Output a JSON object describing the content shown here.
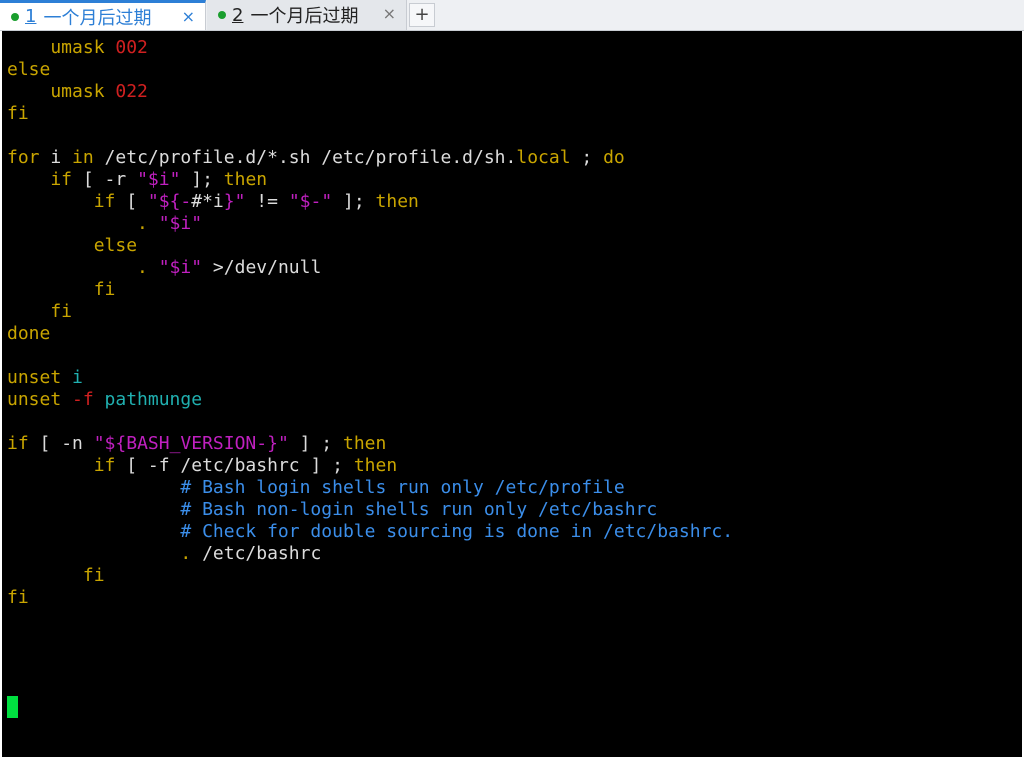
{
  "tabs": [
    {
      "number": "1",
      "title": "一个月后过期",
      "active": true,
      "close": "×",
      "status": "connected"
    },
    {
      "number": "2",
      "title": "一个月后过期",
      "active": false,
      "close": "×",
      "status": "connected"
    }
  ],
  "new_tab_label": "+",
  "colors": {
    "background": "#000000",
    "default": "#dcdcdc",
    "keyword": "#c9a500",
    "number": "#d02020",
    "string": "#c020c0",
    "variable": "#20b0b0",
    "comment": "#3b8eea",
    "cursor": "#00e040",
    "accent": "#2d7fd6"
  },
  "terminal": {
    "lines": [
      [
        [
          "    umask ",
          "keyword"
        ],
        [
          "002",
          "number"
        ]
      ],
      [
        [
          "else",
          "keyword"
        ]
      ],
      [
        [
          "    umask ",
          "keyword"
        ],
        [
          "022",
          "number"
        ]
      ],
      [
        [
          "fi",
          "keyword"
        ]
      ],
      [],
      [
        [
          "for",
          "keyword"
        ],
        [
          " i ",
          "default"
        ],
        [
          "in",
          "keyword"
        ],
        [
          " /etc/profile.d/*.sh /etc/profile.d/sh.",
          "default"
        ],
        [
          "local",
          "keyword"
        ],
        [
          " ; ",
          "default"
        ],
        [
          "do",
          "keyword"
        ]
      ],
      [
        [
          "    if",
          "keyword"
        ],
        [
          " [ -r ",
          "default"
        ],
        [
          "\"$i\"",
          "string"
        ],
        [
          " ]; ",
          "default"
        ],
        [
          "then",
          "keyword"
        ]
      ],
      [
        [
          "        if",
          "keyword"
        ],
        [
          " [ ",
          "default"
        ],
        [
          "\"${-",
          "string"
        ],
        [
          "#*i",
          "default"
        ],
        [
          "}\"",
          "string"
        ],
        [
          " != ",
          "default"
        ],
        [
          "\"$-\"",
          "string"
        ],
        [
          " ]; ",
          "default"
        ],
        [
          "then",
          "keyword"
        ]
      ],
      [
        [
          "            . ",
          "keyword"
        ],
        [
          "\"$i\"",
          "string"
        ]
      ],
      [
        [
          "        else",
          "keyword"
        ]
      ],
      [
        [
          "            . ",
          "keyword"
        ],
        [
          "\"$i\"",
          "string"
        ],
        [
          " >",
          "default"
        ],
        [
          "/dev/null",
          "default"
        ]
      ],
      [
        [
          "        fi",
          "keyword"
        ]
      ],
      [
        [
          "    fi",
          "keyword"
        ]
      ],
      [
        [
          "done",
          "keyword"
        ]
      ],
      [],
      [
        [
          "unset",
          "keyword"
        ],
        [
          " i",
          "variable"
        ]
      ],
      [
        [
          "unset",
          "keyword"
        ],
        [
          " -f",
          "number"
        ],
        [
          " pathmunge",
          "variable"
        ]
      ],
      [],
      [
        [
          "if",
          "keyword"
        ],
        [
          " [ -n ",
          "default"
        ],
        [
          "\"${BASH_VERSION-}\"",
          "string"
        ],
        [
          " ] ; ",
          "default"
        ],
        [
          "then",
          "keyword"
        ]
      ],
      [
        [
          "        if",
          "keyword"
        ],
        [
          " [ -f ",
          "default"
        ],
        [
          "/etc/bashrc",
          "default"
        ],
        [
          " ] ; ",
          "default"
        ],
        [
          "then",
          "keyword"
        ]
      ],
      [
        [
          "                # Bash login shells run only /etc/profile",
          "comment"
        ]
      ],
      [
        [
          "                # Bash non-login shells run only /etc/bashrc",
          "comment"
        ]
      ],
      [
        [
          "                # Check for double sourcing is done in /etc/bashrc.",
          "comment"
        ]
      ],
      [
        [
          "                . ",
          "keyword"
        ],
        [
          "/etc/bashrc",
          "default"
        ]
      ],
      [
        [
          "       fi",
          "keyword"
        ]
      ],
      [
        [
          "fi",
          "keyword"
        ]
      ]
    ]
  }
}
